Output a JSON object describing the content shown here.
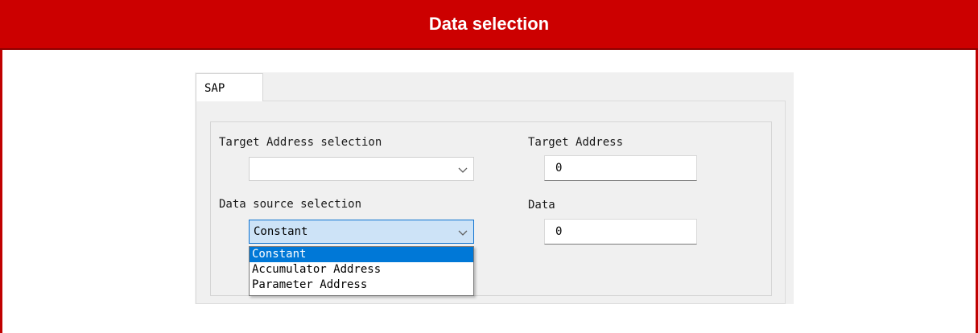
{
  "window": {
    "title": "Data selection",
    "accent_color": "#cc0000"
  },
  "tabs": [
    {
      "label": "SAP",
      "selected": true
    }
  ],
  "form": {
    "target_address_selection": {
      "label": "Target Address selection",
      "value": ""
    },
    "target_address": {
      "label": "Target Address",
      "value": "0"
    },
    "data_source_selection": {
      "label": "Data source selection",
      "value": "Constant",
      "options": [
        "Constant",
        "Accumulator Address",
        "Parameter Address"
      ],
      "open": true
    },
    "data": {
      "label": "Data",
      "value": "0"
    }
  },
  "icons": {
    "combo_arrow": "chevron-down-icon"
  }
}
